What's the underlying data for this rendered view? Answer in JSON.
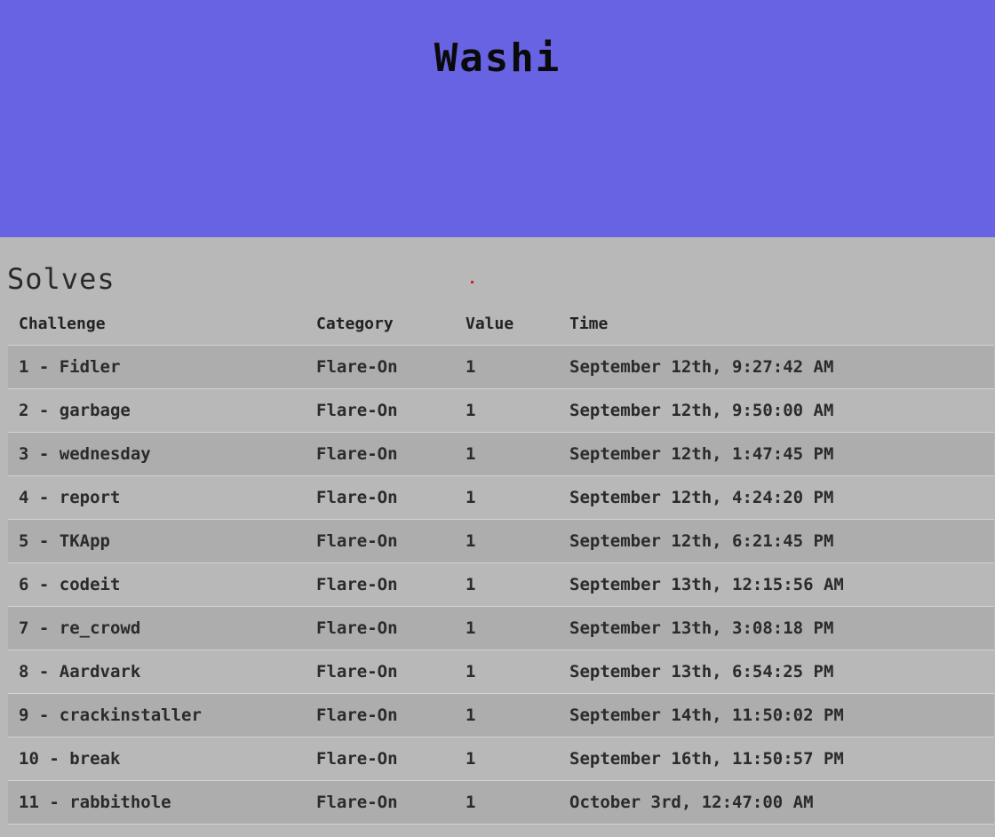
{
  "banner": {
    "title": "Washi",
    "color": "#6763e2"
  },
  "solves": {
    "title": "Solves",
    "columns": [
      "Challenge",
      "Category",
      "Value",
      "Time"
    ],
    "rows": [
      {
        "challenge": "1 - Fidler",
        "category": "Flare-On",
        "value": "1",
        "time": "September 12th, 9:27:42 AM"
      },
      {
        "challenge": "2 - garbage",
        "category": "Flare-On",
        "value": "1",
        "time": "September 12th, 9:50:00 AM"
      },
      {
        "challenge": "3 - wednesday",
        "category": "Flare-On",
        "value": "1",
        "time": "September 12th, 1:47:45 PM"
      },
      {
        "challenge": "4 - report",
        "category": "Flare-On",
        "value": "1",
        "time": "September 12th, 4:24:20 PM"
      },
      {
        "challenge": "5 - TKApp",
        "category": "Flare-On",
        "value": "1",
        "time": "September 12th, 6:21:45 PM"
      },
      {
        "challenge": "6 - codeit",
        "category": "Flare-On",
        "value": "1",
        "time": "September 13th, 12:15:56 AM"
      },
      {
        "challenge": "7 - re_crowd",
        "category": "Flare-On",
        "value": "1",
        "time": "September 13th, 3:08:18 PM"
      },
      {
        "challenge": "8 - Aardvark",
        "category": "Flare-On",
        "value": "1",
        "time": "September 13th, 6:54:25 PM"
      },
      {
        "challenge": "9 - crackinstaller",
        "category": "Flare-On",
        "value": "1",
        "time": "September 14th, 11:50:02 PM"
      },
      {
        "challenge": "10 - break",
        "category": "Flare-On",
        "value": "1",
        "time": "September 16th, 11:50:57 PM"
      },
      {
        "challenge": "11 - rabbithole",
        "category": "Flare-On",
        "value": "1",
        "time": "October 3rd, 12:47:00 AM"
      }
    ]
  }
}
